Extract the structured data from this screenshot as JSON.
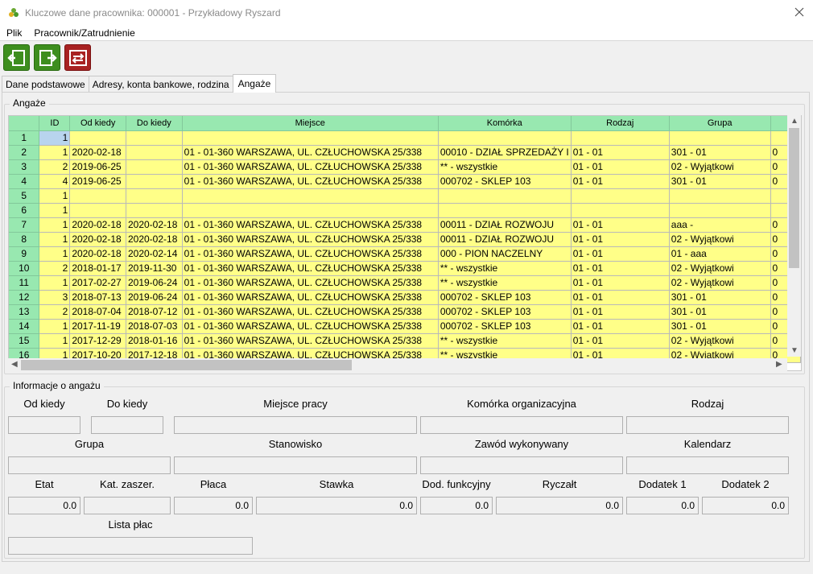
{
  "window": {
    "title": "Kluczowe dane pracownika: 000001 - Przykładowy Ryszard"
  },
  "menu": [
    "Plik",
    "Pracownik/Zatrudnienie"
  ],
  "tabs": [
    "Dane podstawowe",
    "Adresy, konta bankowe, rodzina",
    "Angaże"
  ],
  "grid_group": {
    "legend": "Angaże"
  },
  "grid": {
    "columns": [
      "",
      "ID",
      "Od kiedy",
      "Do kiedy",
      "Miejsce",
      "Komórka",
      "Rodzaj",
      "Grupa"
    ],
    "rows": [
      [
        "1",
        "1",
        "",
        "",
        "",
        "",
        "",
        "",
        ""
      ],
      [
        "2",
        "1",
        "2020-02-18",
        "",
        "01 - 01-360 WARSZAWA, UL. CZŁUCHOWSKA 25/338",
        "00010 - DZIAŁ SPRZEDAŻY I",
        "01 - 01",
        "301 - 01",
        "0"
      ],
      [
        "3",
        "2",
        "2019-06-25",
        "",
        "01 - 01-360 WARSZAWA, UL. CZŁUCHOWSKA 25/338",
        "** - wszystkie",
        "01 - 01",
        "02 - Wyjątkowi",
        "0"
      ],
      [
        "4",
        "4",
        "2019-06-25",
        "",
        "01 - 01-360 WARSZAWA, UL. CZŁUCHOWSKA 25/338",
        "000702 - SKLEP 103",
        "01 - 01",
        "301 - 01",
        "0"
      ],
      [
        "5",
        "1",
        "",
        "",
        "",
        "",
        "",
        "",
        ""
      ],
      [
        "6",
        "1",
        "",
        "",
        "",
        "",
        "",
        "",
        ""
      ],
      [
        "7",
        "1",
        "2020-02-18",
        "2020-02-18",
        "01 - 01-360 WARSZAWA, UL. CZŁUCHOWSKA 25/338",
        "00011 - DZIAŁ ROZWOJU",
        "01 - 01",
        "aaa -",
        "0"
      ],
      [
        "8",
        "1",
        "2020-02-18",
        "2020-02-18",
        "01 - 01-360 WARSZAWA, UL. CZŁUCHOWSKA 25/338",
        "00011 - DZIAŁ ROZWOJU",
        "01 - 01",
        "02 - Wyjątkowi",
        "0"
      ],
      [
        "9",
        "1",
        "2020-02-18",
        "2020-02-14",
        "01 - 01-360 WARSZAWA, UL. CZŁUCHOWSKA 25/338",
        "000 - PION NACZELNY",
        "01 - 01",
        "01 - aaa",
        "0"
      ],
      [
        "10",
        "2",
        "2018-01-17",
        "2019-11-30",
        "01 - 01-360 WARSZAWA, UL. CZŁUCHOWSKA 25/338",
        "** - wszystkie",
        "01 - 01",
        "02 - Wyjątkowi",
        "0"
      ],
      [
        "11",
        "1",
        "2017-02-27",
        "2019-06-24",
        "01 - 01-360 WARSZAWA, UL. CZŁUCHOWSKA 25/338",
        "** - wszystkie",
        "01 - 01",
        "02 - Wyjątkowi",
        "0"
      ],
      [
        "12",
        "3",
        "2018-07-13",
        "2019-06-24",
        "01 - 01-360 WARSZAWA, UL. CZŁUCHOWSKA 25/338",
        "000702 - SKLEP 103",
        "01 - 01",
        "301 - 01",
        "0"
      ],
      [
        "13",
        "2",
        "2018-07-04",
        "2018-07-12",
        "01 - 01-360 WARSZAWA, UL. CZŁUCHOWSKA 25/338",
        "000702 - SKLEP 103",
        "01 - 01",
        "301 - 01",
        "0"
      ],
      [
        "14",
        "1",
        "2017-11-19",
        "2018-07-03",
        "01 - 01-360 WARSZAWA, UL. CZŁUCHOWSKA 25/338",
        "000702 - SKLEP 103",
        "01 - 01",
        "301 - 01",
        "0"
      ],
      [
        "15",
        "1",
        "2017-12-29",
        "2018-01-16",
        "01 - 01-360 WARSZAWA, UL. CZŁUCHOWSKA 25/338",
        "** - wszystkie",
        "01 - 01",
        "02 - Wyjątkowi",
        "0"
      ],
      [
        "16",
        "1",
        "2017-10-20",
        "2017-12-18",
        "01 - 01-360 WARSZAWA, UL. CZŁUCHOWSKA 25/338",
        "** - wszystkie",
        "01 - 01",
        "02 - Wyjątkowi",
        "0"
      ]
    ]
  },
  "info_group": {
    "legend": "Informacje o angażu",
    "labels": {
      "od_kiedy": "Od kiedy",
      "do_kiedy": "Do kiedy",
      "miejsce_pracy": "Miejsce pracy",
      "komorka": "Komórka organizacyjna",
      "rodzaj": "Rodzaj",
      "grupa": "Grupa",
      "stanowisko": "Stanowisko",
      "zawod": "Zawód wykonywany",
      "kalendarz": "Kalendarz",
      "etat": "Etat",
      "kat_zaszer": "Kat. zaszer.",
      "placa": "Płaca",
      "stawka": "Stawka",
      "dod_funkcyjny": "Dod. funkcyjny",
      "ryczalt": "Ryczałt",
      "dodatek1": "Dodatek 1",
      "dodatek2": "Dodatek 2",
      "lista_plac": "Lista płac"
    },
    "values": {
      "etat": "0.0",
      "placa": "0.0",
      "stawka": "0.0",
      "dod_funkcyjny": "0.0",
      "ryczalt": "0.0",
      "dodatek1": "0.0",
      "dodatek2": "0.0"
    }
  },
  "colors": {
    "grid_header": "#98e8b0",
    "grid_cell": "#ffff88",
    "toolbar_green": "#3e8e1e",
    "toolbar_red": "#a82222"
  }
}
